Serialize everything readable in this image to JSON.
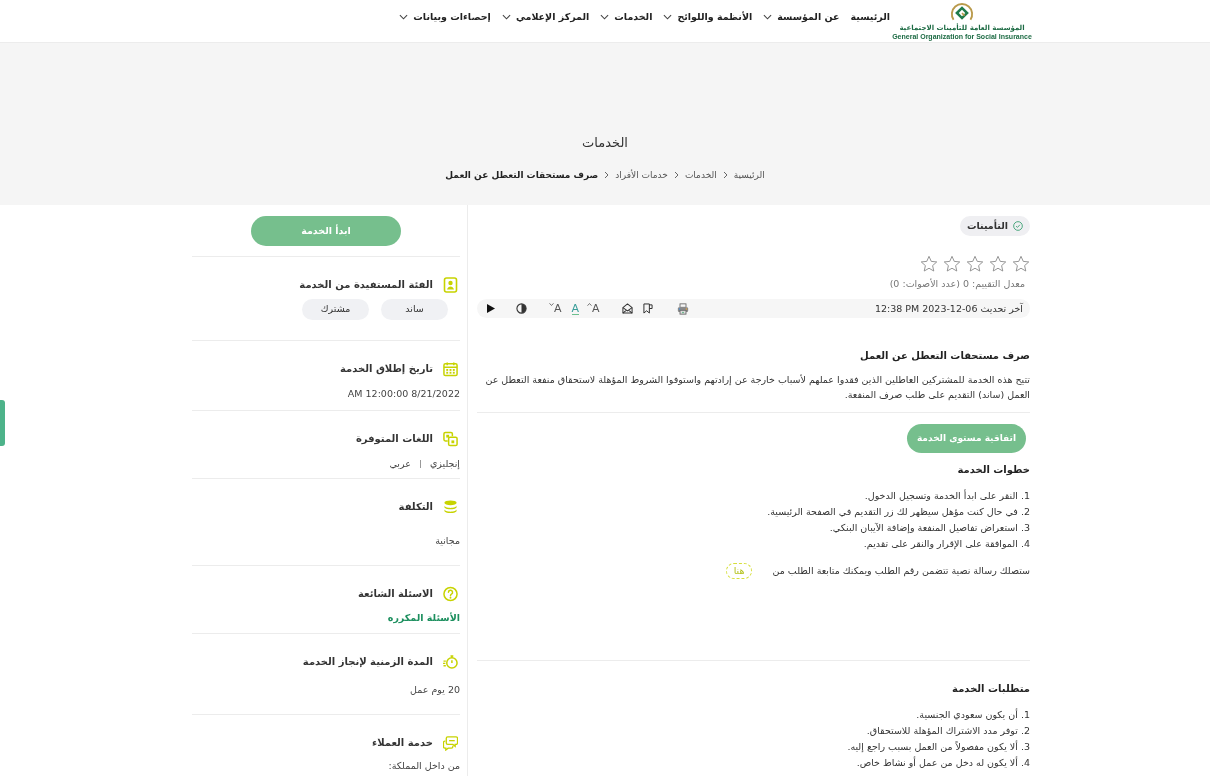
{
  "header": {
    "logo": {
      "name_ar": "المؤسسة العامة للتأمينات الاجتماعية",
      "name_en": "General Organization for Social Insurance"
    },
    "nav": [
      {
        "label": "الرئيسية",
        "dropdown": false
      },
      {
        "label": "عن المؤسسة",
        "dropdown": true
      },
      {
        "label": "الأنظمة واللوائح",
        "dropdown": true
      },
      {
        "label": "الخدمات",
        "dropdown": true
      },
      {
        "label": "المركز الإعلامي",
        "dropdown": true
      },
      {
        "label": "إحصاءات وبيانات",
        "dropdown": true
      }
    ]
  },
  "hero": {
    "title": "الخدمات",
    "breadcrumb": [
      {
        "label": "الرئيسية",
        "current": false
      },
      {
        "label": "الخدمات",
        "current": false
      },
      {
        "label": "خدمات الأفراد",
        "current": false
      },
      {
        "label": "صرف مستحقات التعطل عن العمل",
        "current": true
      }
    ]
  },
  "service": {
    "tag": "التأمينات",
    "rating": {
      "stars": 0,
      "summary": "معدل التقييم: 0 (عدد الأصوات: 0)"
    },
    "toolbar": {
      "updated_label": "آخر تحديث",
      "updated_value": "12:38 PM 2023-12-06",
      "font_controls": [
        {
          "kind": "increase",
          "label": "A"
        },
        {
          "kind": "reset",
          "label": "A"
        },
        {
          "kind": "decrease",
          "label": "A"
        }
      ]
    },
    "title": "صرف مستحقات التعطل عن العمل",
    "description": "تتيح هذه الخدمة للمشتركين العاطلين الذين فقدوا عملهم لأسباب خارجة عن إرادتهم واستوفوا الشروط المؤهلة لاستحقاق منفعة التعطل عن العمل (ساند) التقديم على طلب صرف المنفعة.",
    "sla_button": "اتفاقية مستوى الخدمة",
    "steps": {
      "title": "خطوات الخدمة",
      "items": [
        "1. النقر على ابدأ الخدمة وتسجيل الدخول.",
        "2. في حال كنت مؤهل سيظهر لك زر التقديم في الصفحة الرئيسية.",
        "3. استعراض تفاصيل المنفعة وإضافة الآيبان البنكي.",
        "4. الموافقة على الإقرار والنقر على تقديم."
      ],
      "note": "ستصلك رسالة نصية تتضمن رقم الطلب ويمكنك متابعة الطلب من",
      "note_link": "هنا"
    },
    "requirements": {
      "title": "متطلبات الخدمة",
      "items": [
        "1. أن يكون سعودي الجنسية.",
        "2. توفر مدد الاشتراك المؤهلة للاستحقاق.",
        "3. ألا يكون مفصولاً من العمل بسبب راجع إليه.",
        "4. ألا يكون له دخل من عمل أو نشاط خاص."
      ]
    }
  },
  "sidebar": {
    "start_button": "ابدأ الخدمة",
    "sections": [
      {
        "kind": "chips",
        "title": "الفئة المستفيدة من الخدمة",
        "chips": [
          "ساند",
          "مشترك"
        ]
      },
      {
        "kind": "text",
        "title": "تاريخ إطلاق الخدمة",
        "value": "8/21/2022 12:00:00 AM"
      },
      {
        "kind": "list",
        "title": "اللغات المتوفرة",
        "items": [
          "إنجليزي",
          "عربي"
        ]
      },
      {
        "kind": "text",
        "title": "التكلفة",
        "value": "مجانية"
      },
      {
        "kind": "link",
        "title": "الاسئلة الشائعة",
        "value": "الأسئلة المكرره"
      },
      {
        "kind": "text",
        "title": "المدة الزمنية لإنجاز الخدمة",
        "value": "20 يوم عمل"
      },
      {
        "kind": "text",
        "title": "خدمة العملاء",
        "value": "من داخل المملكة:"
      }
    ]
  }
}
